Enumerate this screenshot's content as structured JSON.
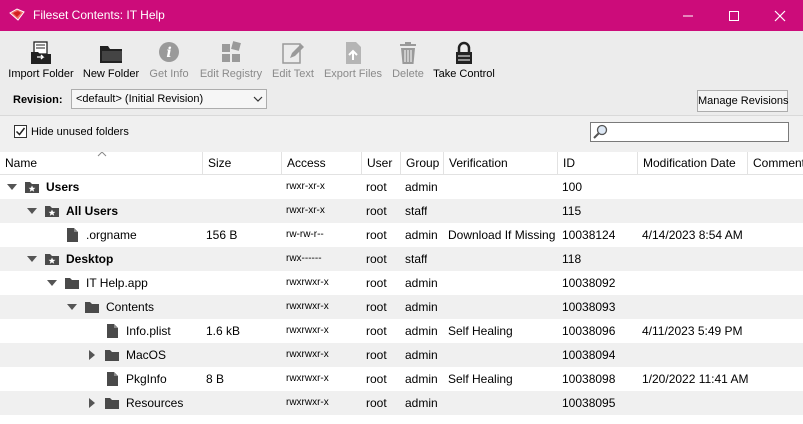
{
  "window": {
    "title": "Fileset Contents: IT Help",
    "titlebar_color": "#cc0c7a"
  },
  "toolbar": {
    "items": [
      {
        "label": "Import Folder",
        "icon": "import-folder-icon",
        "enabled": true
      },
      {
        "label": "New Folder",
        "icon": "new-folder-icon",
        "enabled": true
      },
      {
        "label": "Get Info",
        "icon": "info-icon",
        "enabled": false
      },
      {
        "label": "Edit Registry",
        "icon": "registry-icon",
        "enabled": false
      },
      {
        "label": "Edit Text",
        "icon": "edit-text-icon",
        "enabled": false
      },
      {
        "label": "Export Files",
        "icon": "export-icon",
        "enabled": false
      },
      {
        "label": "Delete",
        "icon": "trash-icon",
        "enabled": false
      },
      {
        "label": "Take Control",
        "icon": "lock-icon",
        "enabled": true
      }
    ]
  },
  "revision": {
    "label": "Revision:",
    "selected": "<default> (Initial Revision)",
    "manage_label": "Manage Revisions"
  },
  "options": {
    "hide_unused_label": "Hide unused folders",
    "hide_unused_checked": true,
    "search_value": ""
  },
  "table": {
    "columns": [
      "Name",
      "Size",
      "Access",
      "User",
      "Group",
      "Verification",
      "ID",
      "Modification Date",
      "Comment"
    ],
    "rows": [
      {
        "name": "Users",
        "bold": true,
        "type": "folder-star",
        "expander": "open",
        "size": "",
        "access": "rwxr-xr-x",
        "user": "root",
        "group": "admin",
        "verification": "",
        "id": "100",
        "date": ""
      },
      {
        "name": "All Users",
        "bold": true,
        "type": "folder-star",
        "expander": "open",
        "size": "",
        "access": "rwxr-xr-x",
        "user": "root",
        "group": "staff",
        "verification": "",
        "id": "115",
        "date": ""
      },
      {
        "name": ".orgname",
        "bold": false,
        "type": "file",
        "expander": "none",
        "size": "156 B",
        "access": "rw-rw-r--",
        "user": "root",
        "group": "admin",
        "verification": "Download If Missing",
        "id": "10038124",
        "date": "4/14/2023 8:54 AM"
      },
      {
        "name": "Desktop",
        "bold": true,
        "type": "folder-star",
        "expander": "open",
        "size": "",
        "access": "rwx------",
        "user": "root",
        "group": "staff",
        "verification": "",
        "id": "118",
        "date": ""
      },
      {
        "name": "IT Help.app",
        "bold": false,
        "type": "folder",
        "expander": "open",
        "size": "",
        "access": "rwxrwxr-x",
        "user": "root",
        "group": "admin",
        "verification": "",
        "id": "10038092",
        "date": ""
      },
      {
        "name": "Contents",
        "bold": false,
        "type": "folder",
        "expander": "open",
        "size": "",
        "access": "rwxrwxr-x",
        "user": "root",
        "group": "admin",
        "verification": "",
        "id": "10038093",
        "date": ""
      },
      {
        "name": "Info.plist",
        "bold": false,
        "type": "file",
        "expander": "none",
        "size": "1.6 kB",
        "access": "rwxrwxr-x",
        "user": "root",
        "group": "admin",
        "verification": "Self Healing",
        "id": "10038096",
        "date": "4/11/2023 5:49 PM"
      },
      {
        "name": "MacOS",
        "bold": false,
        "type": "folder",
        "expander": "closed",
        "size": "",
        "access": "rwxrwxr-x",
        "user": "root",
        "group": "admin",
        "verification": "",
        "id": "10038094",
        "date": ""
      },
      {
        "name": "PkgInfo",
        "bold": false,
        "type": "file",
        "expander": "none",
        "size": "8 B",
        "access": "rwxrwxr-x",
        "user": "root",
        "group": "admin",
        "verification": "Self Healing",
        "id": "10038098",
        "date": "1/20/2022 11:41 AM"
      },
      {
        "name": "Resources",
        "bold": false,
        "type": "folder",
        "expander": "closed",
        "size": "",
        "access": "rwxrwxr-x",
        "user": "root",
        "group": "admin",
        "verification": "",
        "id": "10038095",
        "date": ""
      }
    ]
  }
}
